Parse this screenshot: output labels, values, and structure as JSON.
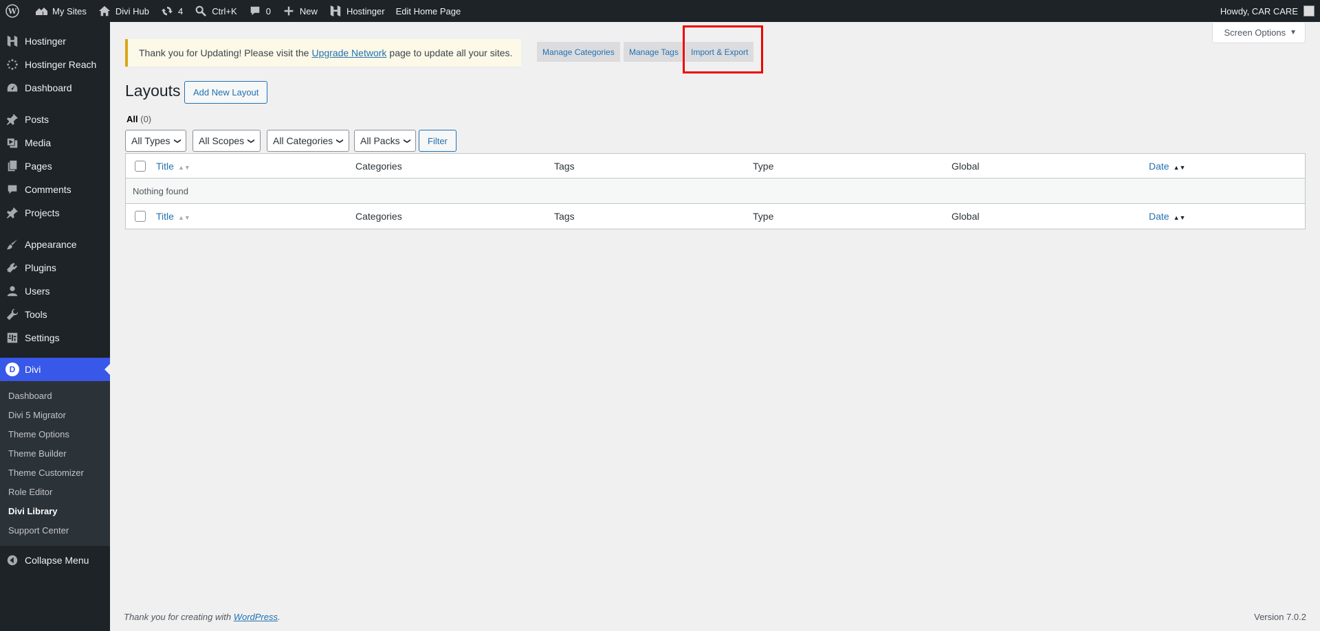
{
  "adminbar": {
    "my_sites": "My Sites",
    "site_name": "Divi Hub",
    "updates_count": "4",
    "search_shortcut": "Ctrl+K",
    "comments_count": "0",
    "new_label": "New",
    "hostinger": "Hostinger",
    "edit_home": "Edit Home Page",
    "howdy": "Howdy, CAR CARE"
  },
  "sidebar": {
    "items": [
      {
        "label": "Hostinger",
        "icon": "hostinger-icon"
      },
      {
        "label": "Hostinger Reach",
        "icon": "reach-icon"
      },
      {
        "label": "Dashboard",
        "icon": "dashboard-icon"
      },
      {
        "label": "Posts",
        "icon": "pin-icon"
      },
      {
        "label": "Media",
        "icon": "media-icon"
      },
      {
        "label": "Pages",
        "icon": "pages-icon"
      },
      {
        "label": "Comments",
        "icon": "comment-icon"
      },
      {
        "label": "Projects",
        "icon": "pin-icon"
      },
      {
        "label": "Appearance",
        "icon": "brush-icon"
      },
      {
        "label": "Plugins",
        "icon": "plugin-icon"
      },
      {
        "label": "Users",
        "icon": "user-icon"
      },
      {
        "label": "Tools",
        "icon": "wrench-icon"
      },
      {
        "label": "Settings",
        "icon": "settings-icon"
      }
    ],
    "divi": {
      "label": "Divi",
      "badge": "D"
    },
    "submenu": [
      "Dashboard",
      "Divi 5 Migrator",
      "Theme Options",
      "Theme Builder",
      "Theme Customizer",
      "Role Editor",
      "Divi Library",
      "Support Center"
    ],
    "collapse": "Collapse Menu"
  },
  "screen_options": "Screen Options",
  "notice": {
    "before": "Thank you for Updating! Please visit the",
    "link": "Upgrade Network",
    "after": "page to update all your sites."
  },
  "library_buttons": {
    "manage_categories": "Manage Categories",
    "manage_tags": "Manage Tags",
    "import_export": "Import & Export"
  },
  "page": {
    "title": "Layouts",
    "add_new": "Add New Layout",
    "all_label": "All",
    "all_count": "(0)"
  },
  "filters": {
    "types": "All Types",
    "scopes": "All Scopes",
    "categories": "All Categories",
    "packs": "All Packs",
    "filter_button": "Filter"
  },
  "table": {
    "columns": {
      "title": "Title",
      "categories": "Categories",
      "tags": "Tags",
      "type": "Type",
      "global": "Global",
      "date": "Date"
    },
    "empty": "Nothing found"
  },
  "footer": {
    "text": "Thank you for creating with",
    "link": "WordPress",
    "version": "Version 7.0.2"
  }
}
